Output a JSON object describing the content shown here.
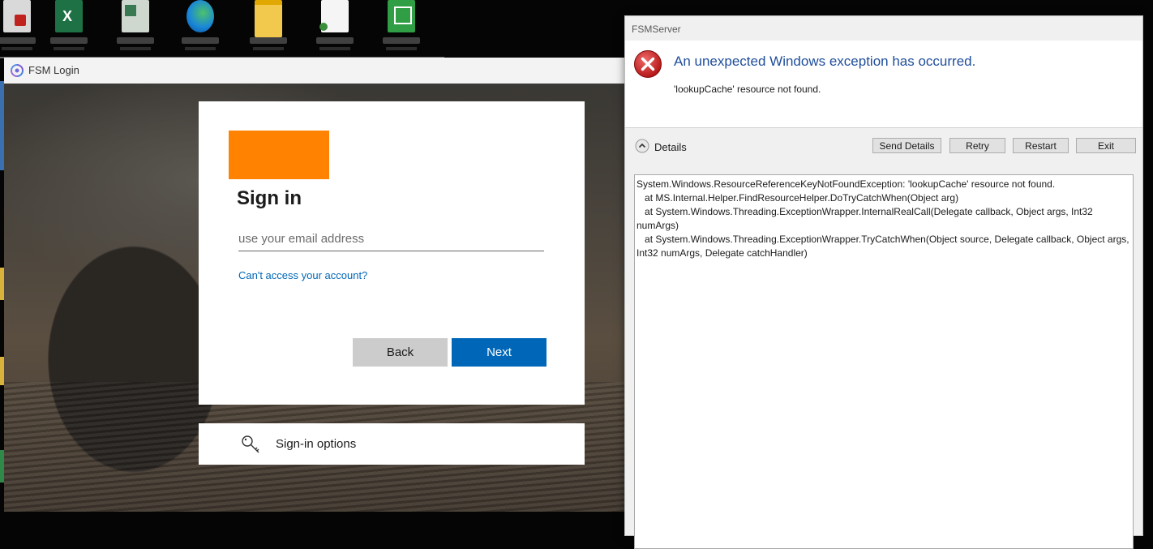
{
  "desktop": {
    "icons": [
      {
        "icon": "acrobat-icon",
        "color": "#c8c8c8",
        "accent": "#c0221e"
      },
      {
        "icon": "excel-icon",
        "color": "#1e7145",
        "accent": "#ffffff"
      },
      {
        "icon": "excel-file-icon",
        "color": "#3a7a52",
        "accent": "#cfcfcf"
      },
      {
        "icon": "edge-icon",
        "color": "#1a88d8",
        "accent": "#4cc26a"
      },
      {
        "icon": "folder-icon",
        "color": "#f2c94c",
        "accent": "#e0a800"
      },
      {
        "icon": "document-icon",
        "color": "#f5f5f5",
        "accent": "#3a8d3a"
      },
      {
        "icon": "calculator-icon",
        "color": "#2f9e44",
        "accent": "#ffffff"
      }
    ]
  },
  "login_window": {
    "title": "FSM Login",
    "signin": {
      "title": "Sign in",
      "email_placeholder": "use your email address",
      "email_value": "",
      "cant_access": "Can't access your account?",
      "back_label": "Back",
      "next_label": "Next",
      "logo_color": "#ff8300"
    },
    "signin_options": {
      "label": "Sign-in options",
      "icon": "key-icon"
    }
  },
  "error_dialog": {
    "title": "FSMServer",
    "heading": "An unexpected Windows exception has occurred.",
    "message": "'lookupCache' resource not found.",
    "details_label": "Details",
    "buttons": {
      "send_details": "Send Details",
      "retry": "Retry",
      "restart": "Restart",
      "exit": "Exit"
    },
    "details_text": "System.Windows.ResourceReferenceKeyNotFoundException: 'lookupCache' resource not found.\n   at MS.Internal.Helper.FindResourceHelper.DoTryCatchWhen(Object arg)\n   at System.Windows.Threading.ExceptionWrapper.InternalRealCall(Delegate callback, Object args, Int32 numArgs)\n   at System.Windows.Threading.ExceptionWrapper.TryCatchWhen(Object source, Delegate callback, Object args, Int32 numArgs, Delegate catchHandler)"
  }
}
